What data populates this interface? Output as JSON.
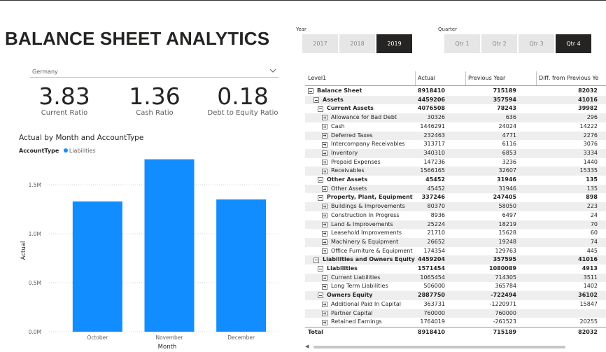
{
  "title": "BALANCE SHEET ANALYTICS",
  "year_slicer": {
    "label": "Year",
    "options": [
      "2017",
      "2018",
      "2019"
    ],
    "selected": "2019"
  },
  "quarter_slicer": {
    "label": "Quarter",
    "options": [
      "Qtr 1",
      "Qtr 2",
      "Qtr 3",
      "Qtr 4"
    ],
    "selected": "Qtr 4"
  },
  "country_dropdown": {
    "value": "Germany",
    "chevron": "chevron-down-icon"
  },
  "kpis": [
    {
      "value": "3.83",
      "label": "Current Ratio"
    },
    {
      "value": "1.36",
      "label": "Cash Ratio"
    },
    {
      "value": "0.18",
      "label": "Debt to Equity Ratio"
    }
  ],
  "chart_data": {
    "type": "bar",
    "title": "Actual by Month and AccountType",
    "legend_title": "AccountType",
    "legend_position": "top-left",
    "categories": [
      "October",
      "November",
      "December"
    ],
    "series": [
      {
        "name": "Liabilities",
        "values": [
          1330000,
          1760000,
          1350000
        ]
      }
    ],
    "xlabel": "Month",
    "ylabel": "Actual",
    "ylim": [
      0,
      1800000
    ],
    "yticks": [
      0,
      500000,
      1000000,
      1500000
    ],
    "ytick_labels": [
      "0.0M",
      "0.5M",
      "1.0M",
      "1.5M"
    ],
    "grid": true,
    "color": "#118DFF"
  },
  "matrix": {
    "headers": [
      "Level1",
      "Actual",
      "Previous Year",
      "Diff. from Previous Ye"
    ],
    "rows": [
      {
        "label": "Balance Sheet",
        "level": 0,
        "bold": true,
        "toggle": "minus",
        "actual": "8918410",
        "prev": "715189",
        "diff": "82032"
      },
      {
        "label": "Assets",
        "level": 1,
        "bold": true,
        "toggle": "minus",
        "actual": "4459206",
        "prev": "357594",
        "diff": "41016"
      },
      {
        "label": "Current Assets",
        "level": 2,
        "bold": true,
        "toggle": "minus",
        "actual": "4076508",
        "prev": "78243",
        "diff": "39982"
      },
      {
        "label": "Allowance for Bad Debt",
        "level": 3,
        "bold": false,
        "toggle": "plus",
        "actual": "30326",
        "prev": "636",
        "diff": "296"
      },
      {
        "label": "Cash",
        "level": 3,
        "bold": false,
        "toggle": "plus",
        "actual": "1446291",
        "prev": "24024",
        "diff": "14222"
      },
      {
        "label": "Deferred Taxes",
        "level": 3,
        "bold": false,
        "toggle": "plus",
        "actual": "232463",
        "prev": "4771",
        "diff": "2276"
      },
      {
        "label": "Intercompany Receivables",
        "level": 3,
        "bold": false,
        "toggle": "plus",
        "actual": "313717",
        "prev": "6116",
        "diff": "3076"
      },
      {
        "label": "Inventory",
        "level": 3,
        "bold": false,
        "toggle": "plus",
        "actual": "340310",
        "prev": "6853",
        "diff": "3334"
      },
      {
        "label": "Prepaid Expenses",
        "level": 3,
        "bold": false,
        "toggle": "plus",
        "actual": "147236",
        "prev": "3236",
        "diff": "1440"
      },
      {
        "label": "Receivables",
        "level": 3,
        "bold": false,
        "toggle": "plus",
        "actual": "1566165",
        "prev": "32607",
        "diff": "15335"
      },
      {
        "label": "Other Assets",
        "level": 2,
        "bold": true,
        "toggle": "minus",
        "actual": "45452",
        "prev": "31946",
        "diff": "135"
      },
      {
        "label": "Other Assets",
        "level": 3,
        "bold": false,
        "toggle": "plus",
        "actual": "45452",
        "prev": "31946",
        "diff": "135"
      },
      {
        "label": "Property, Plant, Equipment",
        "level": 2,
        "bold": true,
        "toggle": "minus",
        "actual": "337246",
        "prev": "247405",
        "diff": "898"
      },
      {
        "label": "Buildings & Improvements",
        "level": 3,
        "bold": false,
        "toggle": "plus",
        "actual": "80370",
        "prev": "58050",
        "diff": "223"
      },
      {
        "label": "Construction In Progress",
        "level": 3,
        "bold": false,
        "toggle": "plus",
        "actual": "8936",
        "prev": "6497",
        "diff": "24"
      },
      {
        "label": "Land & Improvements",
        "level": 3,
        "bold": false,
        "toggle": "plus",
        "actual": "25224",
        "prev": "18219",
        "diff": "70"
      },
      {
        "label": "Leasehold Improvements",
        "level": 3,
        "bold": false,
        "toggle": "plus",
        "actual": "21710",
        "prev": "15628",
        "diff": "60"
      },
      {
        "label": "Machinery & Equipment",
        "level": 3,
        "bold": false,
        "toggle": "plus",
        "actual": "26652",
        "prev": "19248",
        "diff": "74"
      },
      {
        "label": "Office Furniture & Equipment",
        "level": 3,
        "bold": false,
        "toggle": "plus",
        "actual": "174354",
        "prev": "129763",
        "diff": "445"
      },
      {
        "label": "Liabilities and Owners Equity",
        "level": 1,
        "bold": true,
        "toggle": "minus",
        "actual": "4459204",
        "prev": "357595",
        "diff": "41016"
      },
      {
        "label": "Liabilities",
        "level": 2,
        "bold": true,
        "toggle": "minus",
        "actual": "1571454",
        "prev": "1080089",
        "diff": "4913"
      },
      {
        "label": "Current Liabilities",
        "level": 3,
        "bold": false,
        "toggle": "plus",
        "actual": "1065454",
        "prev": "714305",
        "diff": "3511"
      },
      {
        "label": "Long Term Liabilities",
        "level": 3,
        "bold": false,
        "toggle": "plus",
        "actual": "506000",
        "prev": "365784",
        "diff": "1402"
      },
      {
        "label": "Owners Equity",
        "level": 2,
        "bold": true,
        "toggle": "minus",
        "actual": "2887750",
        "prev": "-722494",
        "diff": "36102"
      },
      {
        "label": "Additional Paid In Capital",
        "level": 3,
        "bold": false,
        "toggle": "plus",
        "actual": "363731",
        "prev": "-1220971",
        "diff": "15847"
      },
      {
        "label": "Partner Capital",
        "level": 3,
        "bold": false,
        "toggle": "plus",
        "actual": "760000",
        "prev": "760000",
        "diff": ""
      },
      {
        "label": "Retained Earnings",
        "level": 3,
        "bold": false,
        "toggle": "plus",
        "actual": "1764019",
        "prev": "-261523",
        "diff": "20255"
      }
    ],
    "total": {
      "label": "Total",
      "actual": "8918410",
      "prev": "715189",
      "diff": "82032"
    }
  }
}
